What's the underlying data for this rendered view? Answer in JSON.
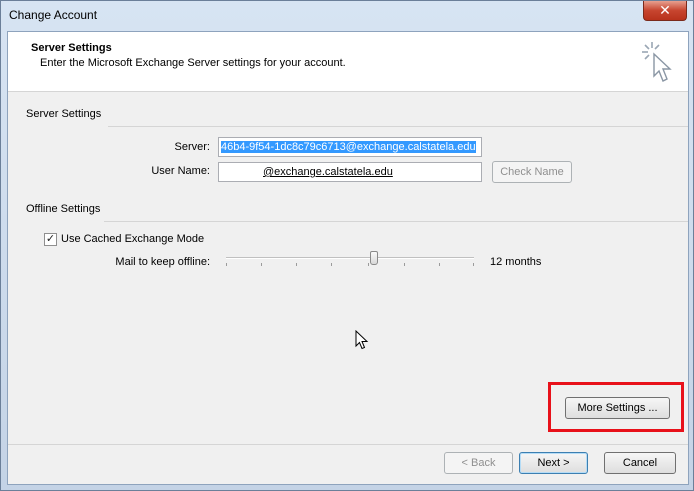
{
  "window": {
    "title": "Change Account",
    "close_glyph": "✕"
  },
  "header": {
    "title": "Server Settings",
    "subtitle": "Enter the Microsoft Exchange Server settings for your account."
  },
  "server_settings": {
    "section_label": "Server Settings",
    "server_label": "Server:",
    "server_value": "46b4-9f54-1dc8c79c6713@exchange.calstatela.edu",
    "username_label": "User Name:",
    "username_value": "@exchange.calstatela.edu",
    "check_name_label": "Check Name"
  },
  "offline_settings": {
    "section_label": "Offline Settings",
    "cached_mode_label": "Use Cached Exchange Mode",
    "cached_mode_checked": true,
    "mail_keep_label": "Mail to keep offline:",
    "mail_keep_value": "12 months"
  },
  "buttons": {
    "more_settings": "More Settings ...",
    "back": "< Back",
    "next": "Next >",
    "cancel": "Cancel"
  },
  "colors": {
    "highlight": "#e8111a",
    "selection": "#3399ff"
  }
}
